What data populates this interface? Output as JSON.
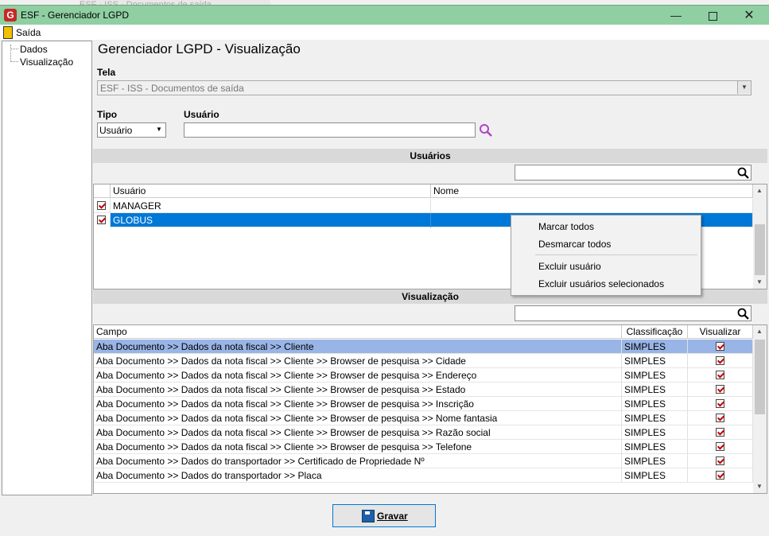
{
  "background_window": {
    "title": "ESF - ISS - Documentos de saída"
  },
  "window": {
    "title": "ESF - Gerenciador LGPD",
    "logo": "G"
  },
  "menubar": {
    "exit_label": "Saída"
  },
  "tree": {
    "items": [
      "Dados",
      "Visualização"
    ]
  },
  "page": {
    "title": "Gerenciador LGPD - Visualização",
    "screen_label": "Tela",
    "screen_value": "ESF - ISS - Documentos de saída",
    "type_label": "Tipo",
    "type_value": "Usuário",
    "user_label": "Usuário",
    "user_value": ""
  },
  "users": {
    "header": "Usuários",
    "search_value": "",
    "columns": [
      "Usuário",
      "Nome"
    ],
    "rows": [
      {
        "user": "MANAGER",
        "name": "",
        "checked": true
      },
      {
        "user": "GLOBUS",
        "name": "",
        "checked": true,
        "selected": true
      }
    ]
  },
  "context_menu": {
    "items": [
      "Marcar todos",
      "Desmarcar todos",
      "Excluir usuário",
      "Excluir usuários selecionados"
    ]
  },
  "visualization": {
    "header": "Visualização",
    "search_value": "",
    "columns": [
      "Campo",
      "Classificação",
      "Visualizar"
    ],
    "rows": [
      {
        "field": "Aba Documento >> Dados da nota fiscal >> Cliente",
        "class": "SIMPLES",
        "view": true,
        "selected": true
      },
      {
        "field": "Aba Documento >> Dados da nota fiscal >> Cliente >> Browser de pesquisa >> Cidade",
        "class": "SIMPLES",
        "view": true
      },
      {
        "field": "Aba Documento >> Dados da nota fiscal >> Cliente >> Browser de pesquisa >> Endereço",
        "class": "SIMPLES",
        "view": true
      },
      {
        "field": "Aba Documento >> Dados da nota fiscal >> Cliente >> Browser de pesquisa >> Estado",
        "class": "SIMPLES",
        "view": true
      },
      {
        "field": "Aba Documento >> Dados da nota fiscal >> Cliente >> Browser de pesquisa >> Inscrição",
        "class": "SIMPLES",
        "view": true
      },
      {
        "field": "Aba Documento >> Dados da nota fiscal >> Cliente >> Browser de pesquisa >> Nome fantasia",
        "class": "SIMPLES",
        "view": true
      },
      {
        "field": "Aba Documento >> Dados da nota fiscal >> Cliente >> Browser de pesquisa >> Razão social",
        "class": "SIMPLES",
        "view": true
      },
      {
        "field": "Aba Documento >> Dados da nota fiscal >> Cliente >> Browser de pesquisa >> Telefone",
        "class": "SIMPLES",
        "view": true
      },
      {
        "field": "Aba Documento >> Dados do transportador >> Certificado de Propriedade Nº",
        "class": "SIMPLES",
        "view": true
      },
      {
        "field": "Aba Documento >> Dados do transportador >> Placa",
        "class": "SIMPLES",
        "view": true
      }
    ]
  },
  "footer": {
    "save_label": "Gravar"
  },
  "colors": {
    "titlebar": "#8fcfa2",
    "selection": "#0078d7",
    "selection_light": "#99b4e6",
    "check": "#c00000"
  }
}
